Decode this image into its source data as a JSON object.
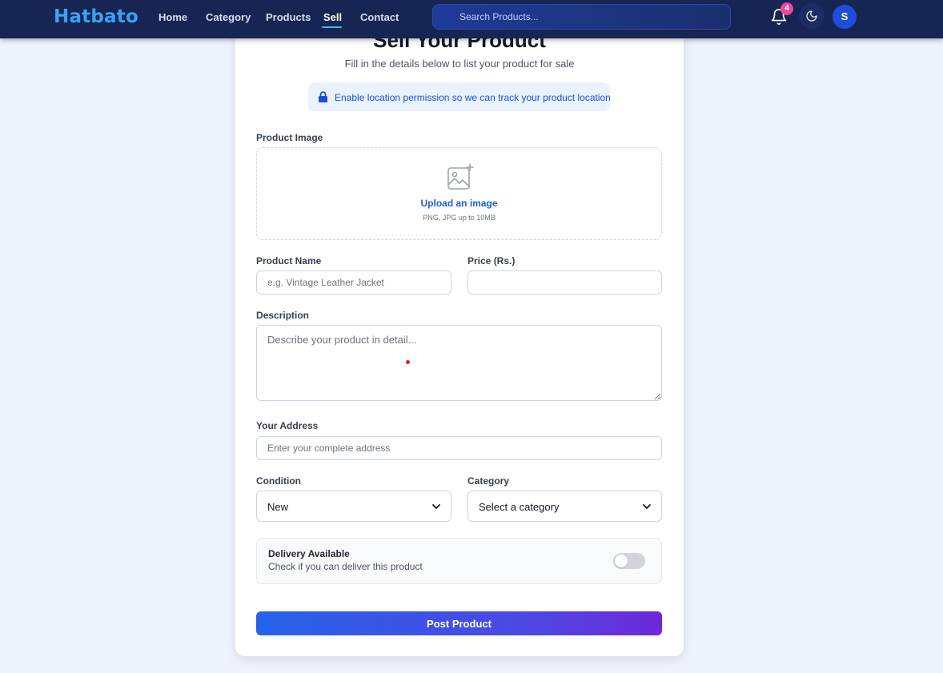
{
  "navbar": {
    "logo": "Hatbato",
    "links": [
      {
        "label": "Home"
      },
      {
        "label": "Category"
      },
      {
        "label": "Products"
      },
      {
        "label": "Sell",
        "active": true
      },
      {
        "label": "Contact"
      }
    ],
    "search_placeholder": "Search Products...",
    "notification_count": "4",
    "avatar_initial": "S",
    "icons": [
      "bell-icon",
      "moon-icon"
    ]
  },
  "form": {
    "title": "Sell Your Product",
    "subtitle": "Fill in the details below to list your product for sale",
    "location_notice": "Enable location permission so we can track your product location",
    "image_label": "Product Image",
    "upload_text": "Upload an image",
    "upload_hint": "PNG, JPG up to 10MB",
    "name_label": "Product Name",
    "name_placeholder": "e.g. Vintage Leather Jacket",
    "price_label": "Price (Rs.)",
    "price_value": "",
    "description_label": "Description",
    "description_placeholder": "Describe your product in detail...",
    "address_label": "Your Address",
    "address_placeholder": "Enter your complete address",
    "condition_label": "Condition",
    "condition_value": "New",
    "category_label": "Category",
    "category_value": "Select a category",
    "delivery_title": "Delivery Available",
    "delivery_desc": "Check if you can deliver this product",
    "delivery_enabled": false,
    "submit_label": "Post Product"
  },
  "colors": {
    "navbar_bg": "#172554",
    "logo": "#38a3f5",
    "accent": "#2563eb",
    "badge": "#ec4899",
    "page_bg": "#eef3fd"
  }
}
